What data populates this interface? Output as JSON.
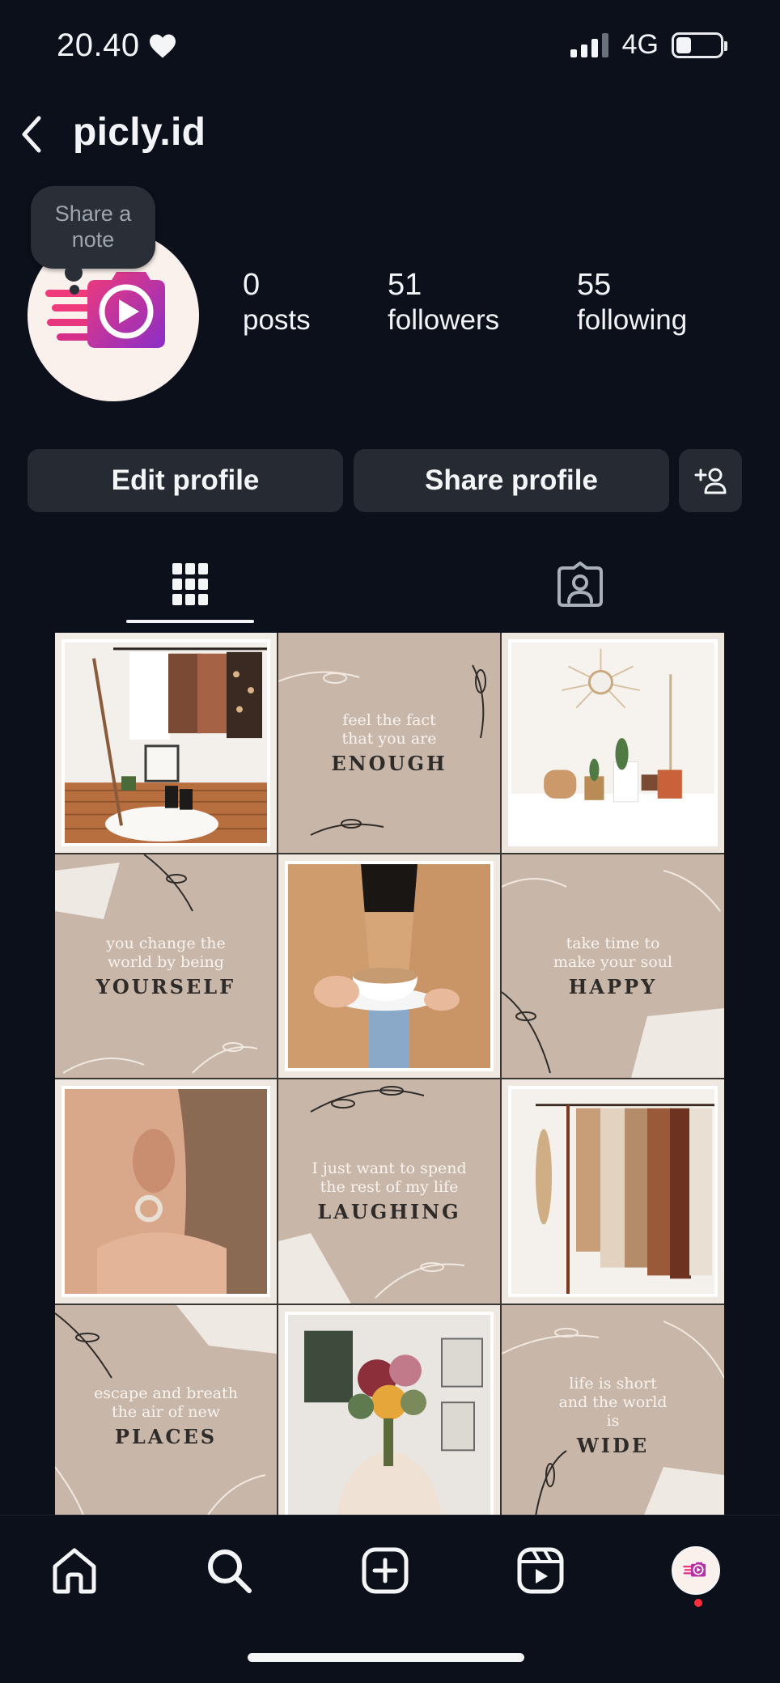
{
  "status_bar": {
    "time": "20.40",
    "network": "4G",
    "battery_level": 0.35
  },
  "header": {
    "username": "picly.id"
  },
  "profile": {
    "note_text": "Share a note",
    "stats": [
      {
        "value": "0",
        "label": "posts"
      },
      {
        "value": "51",
        "label": "followers"
      },
      {
        "value": "55",
        "label": "following"
      }
    ]
  },
  "buttons": {
    "edit_profile": "Edit profile",
    "share_profile": "Share profile"
  },
  "tabs": {
    "active": "grid",
    "items": [
      "grid-icon",
      "tagged-icon"
    ]
  },
  "posts": [
    {
      "type": "photo",
      "subject": "clothing rack"
    },
    {
      "type": "quote",
      "small": "feel the fact that you are",
      "big": "ENOUGH"
    },
    {
      "type": "photo",
      "subject": "sun mirror and plants"
    },
    {
      "type": "quote",
      "small": "you change the world by being",
      "big": "YOURSELF"
    },
    {
      "type": "photo",
      "subject": "coffee cup"
    },
    {
      "type": "quote",
      "small": "take time to make your soul",
      "big": "HAPPY"
    },
    {
      "type": "photo",
      "subject": "earring"
    },
    {
      "type": "quote",
      "small": "I just want to spend the rest of my life",
      "big": "LAUGHING"
    },
    {
      "type": "photo",
      "subject": "sweaters on rack"
    },
    {
      "type": "quote",
      "small": "escape and breath the air of new",
      "big": "PLACES"
    },
    {
      "type": "photo",
      "subject": "flower bouquet"
    },
    {
      "type": "quote",
      "small": "life is short and the world is",
      "big": "WIDE"
    }
  ],
  "colors": {
    "background": "#0b101a",
    "button": "#262b33",
    "tile_beige": "#c8b7a9",
    "brand_pink": "#e2357f",
    "brand_purple": "#8a2ec7",
    "notification_dot": "#ff2d3a"
  },
  "bottom_nav": {
    "items": [
      "home-icon",
      "search-icon",
      "create-icon",
      "reels-icon",
      "profile-avatar"
    ]
  }
}
